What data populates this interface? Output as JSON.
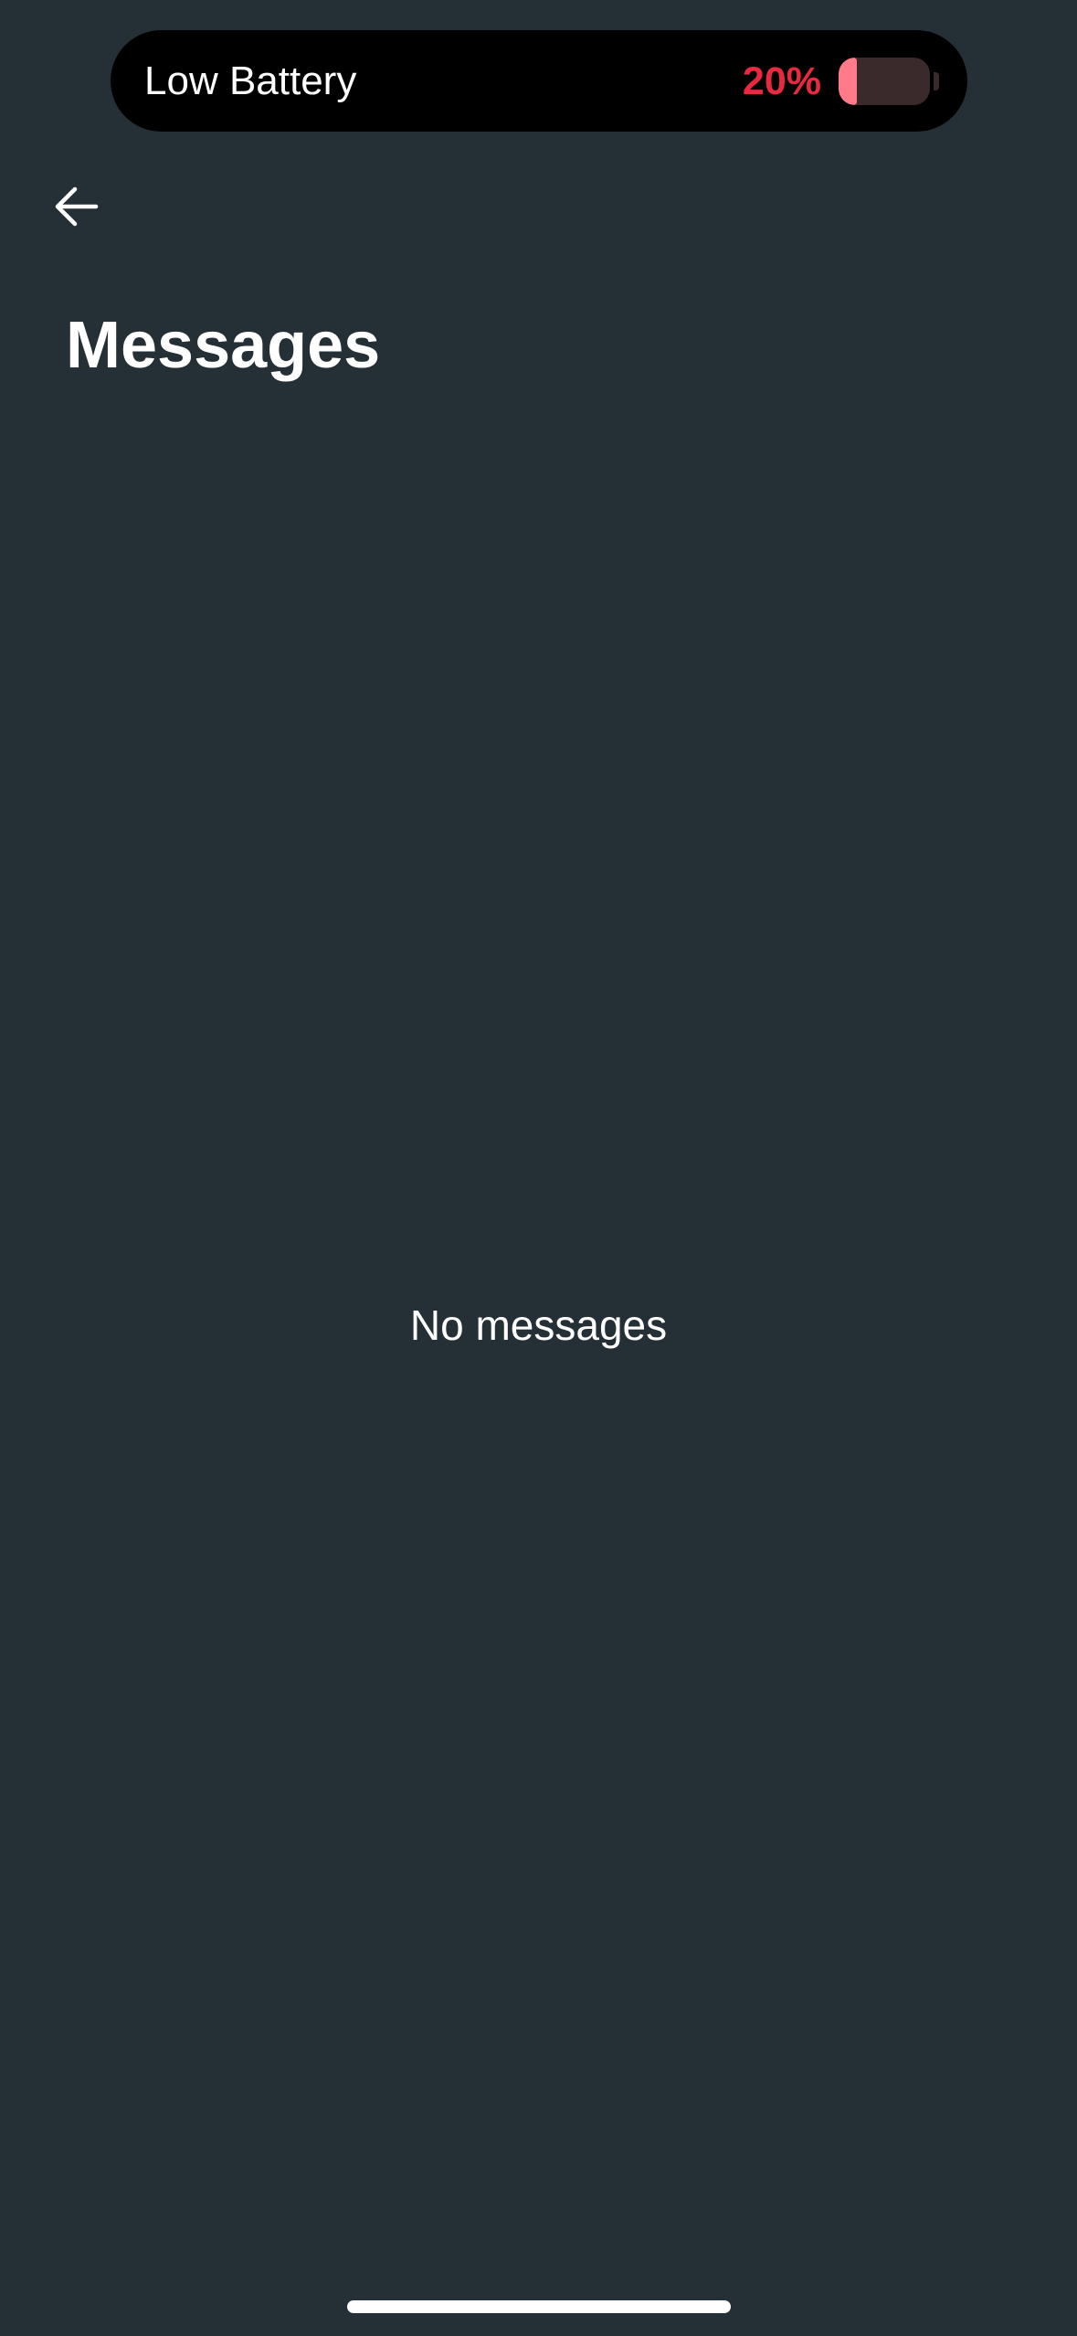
{
  "status_pill": {
    "title": "Low Battery",
    "percent_text": "20%",
    "battery_level": 0.2,
    "accent_color": "#e8293f",
    "fill_color": "#ff7b89"
  },
  "nav": {
    "back_icon": "arrow-left-icon"
  },
  "page": {
    "title": "Messages",
    "empty_text": "No messages"
  },
  "colors": {
    "background": "#252f36"
  }
}
